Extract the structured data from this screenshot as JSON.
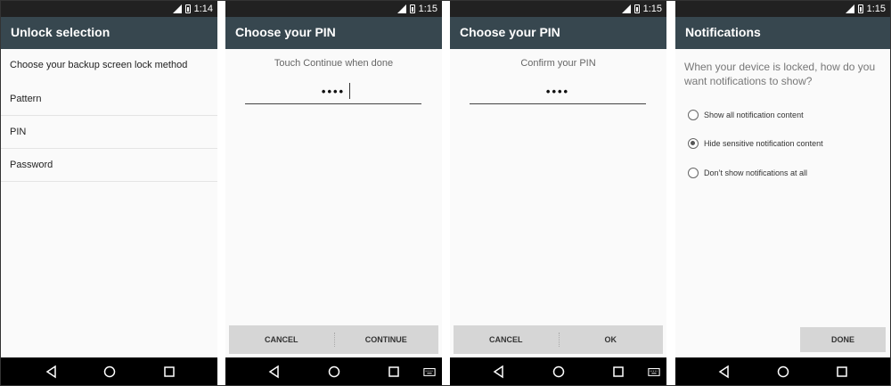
{
  "screens": [
    {
      "time": "1:14",
      "title": "Unlock selection",
      "subtitle": "Choose your backup screen lock method",
      "items": [
        {
          "label": "Pattern"
        },
        {
          "label": "PIN"
        },
        {
          "label": "Password"
        }
      ]
    },
    {
      "time": "1:15",
      "title": "Choose your PIN",
      "hint": "Touch Continue when done",
      "pin_value": "••••",
      "cancel_label": "CANCEL",
      "confirm_label": "CONTINUE"
    },
    {
      "time": "1:15",
      "title": "Choose your PIN",
      "hint": "Confirm your PIN",
      "pin_value": "••••",
      "cancel_label": "CANCEL",
      "confirm_label": "OK"
    },
    {
      "time": "1:15",
      "title": "Notifications",
      "question": "When your device is locked, how do you want notifications to show?",
      "options": [
        {
          "label": "Show all notification content",
          "selected": false
        },
        {
          "label": "Hide sensitive notification content",
          "selected": true
        },
        {
          "label": "Don’t show notifications at all",
          "selected": false
        }
      ],
      "done_label": "DONE"
    }
  ],
  "colors": {
    "appbar": "#37474f",
    "statusbar": "#212121",
    "navbar": "#000000",
    "button_bar": "#d6d6d6"
  },
  "icons": [
    "signal-icon",
    "battery-icon",
    "nav-back-icon",
    "nav-home-icon",
    "nav-recents-icon",
    "keyboard-icon"
  ]
}
